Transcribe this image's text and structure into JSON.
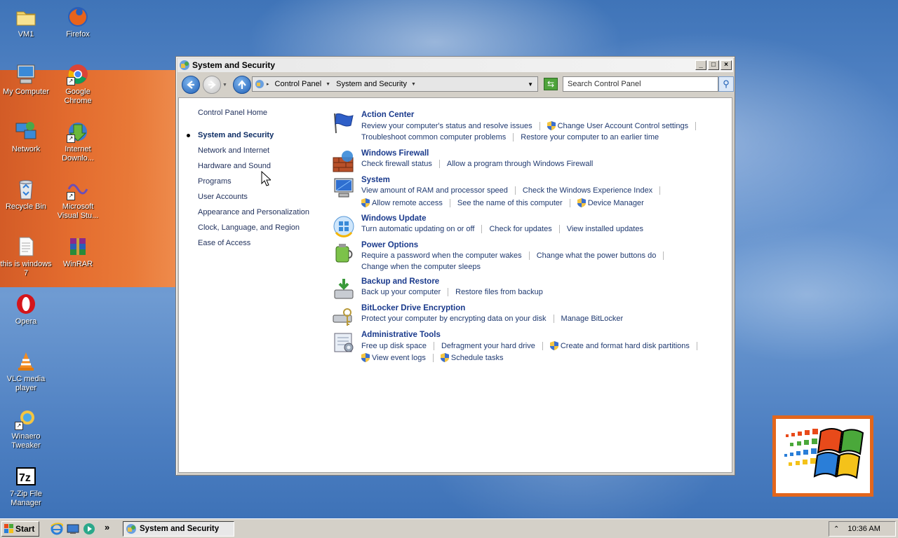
{
  "desktop_icons": [
    {
      "label": "VM1",
      "icon": "folder-icon"
    },
    {
      "label": "Firefox",
      "icon": "firefox-icon"
    },
    {
      "label": "My Computer",
      "icon": "computer-icon"
    },
    {
      "label": "Google Chrome",
      "icon": "chrome-icon"
    },
    {
      "label": "Network",
      "icon": "network-icon"
    },
    {
      "label": "Internet Downlo...",
      "icon": "download-manager-icon"
    },
    {
      "label": "Recycle Bin",
      "icon": "recycle-bin-icon"
    },
    {
      "label": "Microsoft Visual Stu...",
      "icon": "visual-studio-icon"
    },
    {
      "label": "this is windows 7",
      "icon": "text-file-icon"
    },
    {
      "label": "WinRAR",
      "icon": "winrar-icon"
    },
    {
      "label": "Opera",
      "icon": "opera-icon"
    },
    {
      "label": "VLC media player",
      "icon": "vlc-icon"
    },
    {
      "label": "Winaero Tweaker",
      "icon": "winaero-icon"
    },
    {
      "label": "7-Zip File Manager",
      "icon": "7zip-icon"
    }
  ],
  "window": {
    "title": "System and Security",
    "minimize": "_",
    "maximize": "□",
    "close": "×"
  },
  "address": {
    "crumbs": [
      "Control Panel",
      "System and Security"
    ],
    "search_placeholder": "Search Control Panel"
  },
  "leftnav": {
    "home": "Control Panel Home",
    "items": [
      {
        "label": "System and Security",
        "active": true
      },
      {
        "label": "Network and Internet"
      },
      {
        "label": "Hardware and Sound"
      },
      {
        "label": "Programs"
      },
      {
        "label": "User Accounts"
      },
      {
        "label": "Appearance and Personalization"
      },
      {
        "label": "Clock, Language, and Region"
      },
      {
        "label": "Ease of Access"
      }
    ]
  },
  "categories": {
    "action_center": {
      "title": "Action Center",
      "l1": "Review your computer's status and resolve issues",
      "l2": "Change User Account Control settings",
      "l3": "Troubleshoot common computer problems",
      "l4": "Restore your computer to an earlier time"
    },
    "firewall": {
      "title": "Windows Firewall",
      "l1": "Check firewall status",
      "l2": "Allow a program through Windows Firewall"
    },
    "system": {
      "title": "System",
      "l1": "View amount of RAM and processor speed",
      "l2": "Check the Windows Experience Index",
      "l3": "Allow remote access",
      "l4": "See the name of this computer",
      "l5": "Device Manager"
    },
    "update": {
      "title": "Windows Update",
      "l1": "Turn automatic updating on or off",
      "l2": "Check for updates",
      "l3": "View installed updates"
    },
    "power": {
      "title": "Power Options",
      "l1": "Require a password when the computer wakes",
      "l2": "Change what the power buttons do",
      "l3": "Change when the computer sleeps"
    },
    "backup": {
      "title": "Backup and Restore",
      "l1": "Back up your computer",
      "l2": "Restore files from backup"
    },
    "bitlocker": {
      "title": "BitLocker Drive Encryption",
      "l1": "Protect your computer by encrypting data on your disk",
      "l2": "Manage BitLocker"
    },
    "admin": {
      "title": "Administrative Tools",
      "l1": "Free up disk space",
      "l2": "Defragment your hard drive",
      "l3": "Create and format hard disk partitions",
      "l4": "View event logs",
      "l5": "Schedule tasks"
    }
  },
  "taskbar": {
    "start": "Start",
    "more": "»",
    "task": "System and Security",
    "tray_chevron": "⌃",
    "clock": "10:36 AM"
  },
  "colors": {
    "link": "#203a70",
    "title_link": "#1a3a8c",
    "desktop": "#4e80c2",
    "orange": "#ea6a26"
  }
}
